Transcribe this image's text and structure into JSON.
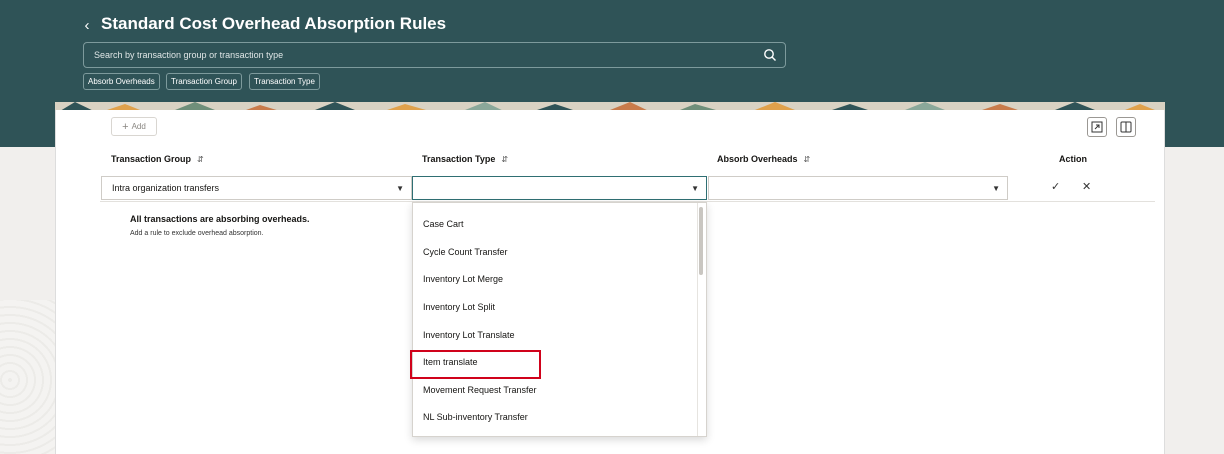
{
  "header": {
    "title": "Standard Cost Overhead Absorption Rules",
    "search_placeholder": "Search by transaction group or transaction type",
    "chips": [
      "Absorb Overheads",
      "Transaction Group",
      "Transaction Type"
    ]
  },
  "toolbar": {
    "add_label": "Add"
  },
  "columns": {
    "transaction_group": "Transaction Group",
    "transaction_type": "Transaction Type",
    "absorb_overheads": "Absorb Overheads",
    "action": "Action"
  },
  "row": {
    "transaction_group_value": "Intra organization transfers",
    "transaction_type_value": "",
    "absorb_overheads_value": ""
  },
  "empty_state": {
    "title": "All transactions are absorbing overheads.",
    "subtitle": "Add a rule to exclude overhead absorption."
  },
  "dropdown": {
    "options": [
      "Case Cart",
      "Cycle Count Transfer",
      "Inventory Lot Merge",
      "Inventory Lot Split",
      "Inventory Lot Translate",
      "Item translate",
      "Movement Request Transfer",
      "NL Sub-inventory Transfer"
    ],
    "highlighted": "Item translate"
  },
  "colors": {
    "header_bg": "#2f5357",
    "active_border": "#2f6f73",
    "highlight": "#d0021b"
  }
}
